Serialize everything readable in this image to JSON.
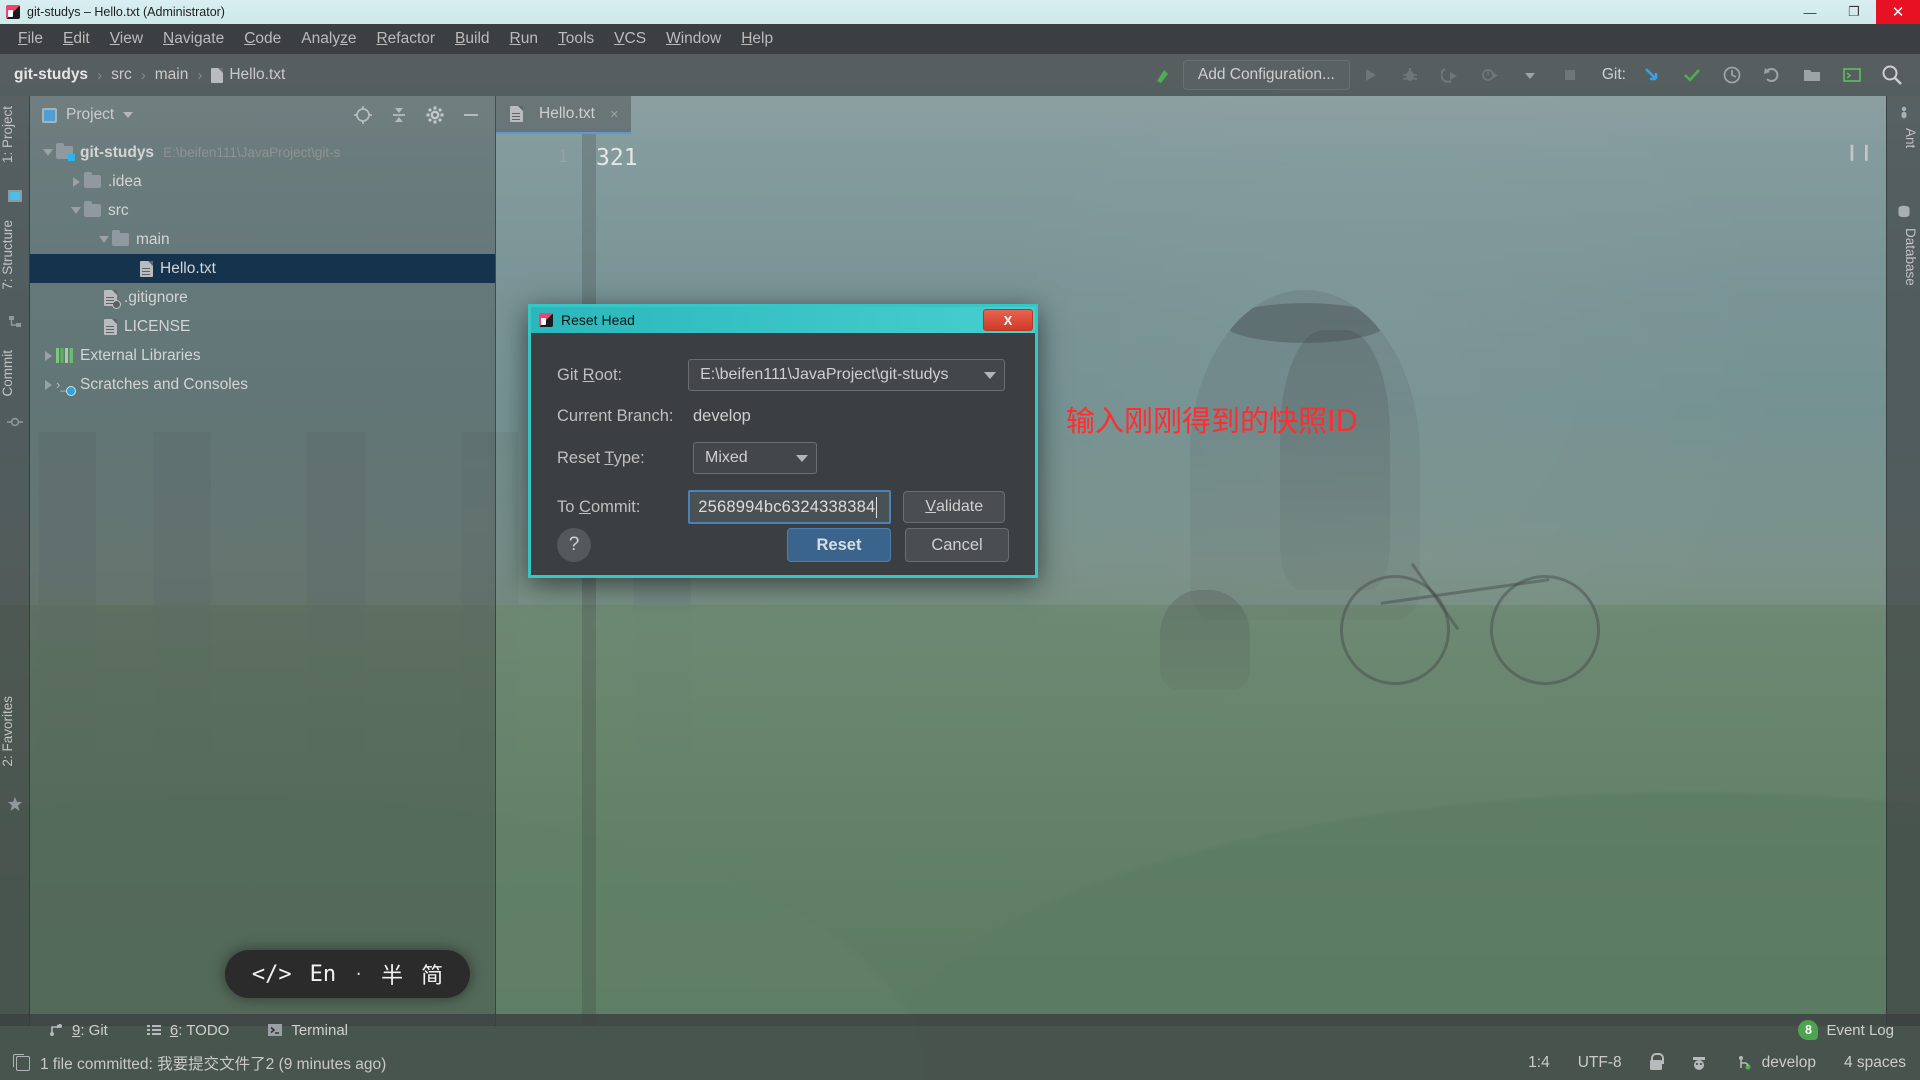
{
  "window": {
    "title": "git-studys – Hello.txt (Administrator)",
    "minimize_label": "—",
    "maximize_label": "❐",
    "close_label": "✕"
  },
  "menubar": {
    "items": [
      {
        "label": "File",
        "mnemonic": "F"
      },
      {
        "label": "Edit",
        "mnemonic": "E"
      },
      {
        "label": "View",
        "mnemonic": "V"
      },
      {
        "label": "Navigate",
        "mnemonic": "N"
      },
      {
        "label": "Code",
        "mnemonic": "C"
      },
      {
        "label": "Analyze",
        "mnemonic": "A"
      },
      {
        "label": "Refactor",
        "mnemonic": "R"
      },
      {
        "label": "Build",
        "mnemonic": "B"
      },
      {
        "label": "Run",
        "mnemonic": "R"
      },
      {
        "label": "Tools",
        "mnemonic": "T"
      },
      {
        "label": "VCS",
        "mnemonic": "V"
      },
      {
        "label": "Window",
        "mnemonic": "W"
      },
      {
        "label": "Help",
        "mnemonic": "H"
      }
    ]
  },
  "navbar": {
    "breadcrumb": [
      {
        "label": "git-studys",
        "bold": true
      },
      {
        "label": "src",
        "bold": false
      },
      {
        "label": "main",
        "bold": false
      },
      {
        "label": "Hello.txt",
        "bold": false,
        "icon": "file-icon"
      }
    ],
    "separator": "›",
    "add_configuration_label": "Add Configuration...",
    "git_label": "Git:",
    "icons": [
      "build-icon",
      "run-icon",
      "debug-icon",
      "run-coverage-icon",
      "profiler-icon",
      "dropdown-icon",
      "stop-icon",
      "git-update-icon",
      "git-commit-icon",
      "git-history-icon",
      "git-rollback-icon",
      "todo-icon",
      "terminal-icon",
      "search-everywhere-icon"
    ]
  },
  "left_strip": {
    "tabs": [
      {
        "label": "1: Project",
        "number": "1"
      },
      {
        "label": "7: Structure",
        "number": "7"
      },
      {
        "label": "Commit",
        "number": ""
      },
      {
        "label": "2: Favorites",
        "number": "2"
      }
    ]
  },
  "right_strip": {
    "tabs": [
      {
        "label": "Ant"
      },
      {
        "label": "Database"
      }
    ]
  },
  "project_panel": {
    "title": "Project",
    "toolbar_icons": [
      "locate-icon",
      "collapse-all-icon",
      "gear-icon",
      "hide-icon"
    ],
    "tree": [
      {
        "label": "git-studys",
        "path": "E:\\beifen111\\JavaProject\\git-s",
        "indent": 0,
        "twisty": "down",
        "icon": "project-folder-icon",
        "bold": true
      },
      {
        "label": ".idea",
        "path": "",
        "indent": 1,
        "twisty": "right",
        "icon": "folder-icon",
        "bold": false
      },
      {
        "label": "src",
        "path": "",
        "indent": 1,
        "twisty": "down",
        "icon": "folder-icon",
        "bold": false
      },
      {
        "label": "main",
        "path": "",
        "indent": 2,
        "twisty": "down",
        "icon": "folder-icon",
        "bold": false
      },
      {
        "label": "Hello.txt",
        "path": "",
        "indent": 3,
        "twisty": "none",
        "icon": "file-icon",
        "bold": false,
        "selected": true
      },
      {
        "label": ".gitignore",
        "path": "",
        "indent": 2,
        "twisty": "none",
        "icon": "ignored-file-icon",
        "bold": false
      },
      {
        "label": "LICENSE",
        "path": "",
        "indent": 2,
        "twisty": "none",
        "icon": "file-icon",
        "bold": false
      },
      {
        "label": "External Libraries",
        "path": "",
        "indent": 0,
        "twisty": "right",
        "icon": "library-icon",
        "bold": false
      },
      {
        "label": "Scratches and Consoles",
        "path": "",
        "indent": 0,
        "twisty": "right",
        "icon": "scratches-icon",
        "bold": false
      }
    ]
  },
  "editor": {
    "tab_label": "Hello.txt",
    "tab_close": "×",
    "line_number": "1",
    "content": "321",
    "pause_label": "❙❙"
  },
  "annotation": {
    "text": "输入刚刚得到的快照ID",
    "color": "#ff2d2d"
  },
  "ime": {
    "code_glyph": "</>",
    "lang": "En",
    "dot": "·",
    "width_mode": "半",
    "shape_mode": "简"
  },
  "dialog": {
    "title": "Reset Head",
    "close_label": "X",
    "git_root_label": "Git Root:",
    "git_root_mnemonic": "R",
    "git_root_value": "E:\\beifen111\\JavaProject\\git-studys",
    "current_branch_label": "Current Branch:",
    "current_branch_value": "develop",
    "reset_type_label": "Reset Type:",
    "reset_type_mnemonic": "T",
    "reset_type_value": "Mixed",
    "to_commit_label": "To Commit:",
    "to_commit_mnemonic": "C",
    "to_commit_value": "2568994bc6324338384",
    "validate_label": "Validate",
    "validate_mnemonic": "V",
    "help_label": "?",
    "reset_label": "Reset",
    "cancel_label": "Cancel"
  },
  "bottom_bar": {
    "items": [
      {
        "label": "9: Git",
        "number": "9",
        "text": ": Git",
        "icon": "git-branch-icon"
      },
      {
        "label": "6: TODO",
        "number": "6",
        "text": ": TODO",
        "icon": "todo-list-icon"
      },
      {
        "label": "Terminal",
        "number": "",
        "text": "Terminal",
        "icon": "terminal-icon"
      }
    ],
    "event_log_label": "Event Log",
    "event_log_count": "8"
  },
  "status_bar": {
    "message": "1 file committed: 我要提交文件了2 (9 minutes ago)",
    "caret_position": "1:4",
    "encoding": "UTF-8",
    "line_separator_icon": "unlocked-icon",
    "inspection_icon": "hector-icon",
    "branch": "develop",
    "indent": "4 spaces"
  }
}
